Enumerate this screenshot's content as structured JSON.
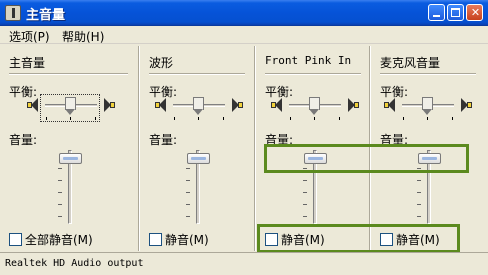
{
  "window": {
    "title": "主音量"
  },
  "menu": {
    "options": "选项(P)",
    "help": "帮助(H)"
  },
  "labels": {
    "balance": "平衡:",
    "volume": "音量:"
  },
  "channels": [
    {
      "title": "主音量",
      "mute_label": "全部静音(M)",
      "muted": false
    },
    {
      "title": "波形",
      "mute_label": "静音(M)",
      "muted": false
    },
    {
      "title": "Front Pink In",
      "mute_label": "静音(M)",
      "muted": false
    },
    {
      "title": "麦克风音量",
      "mute_label": "静音(M)",
      "muted": false
    }
  ],
  "status": {
    "text": "Realtek HD Audio output"
  },
  "colors": {
    "highlight": "#5b8a1e",
    "titlebar": "#0653d8"
  }
}
